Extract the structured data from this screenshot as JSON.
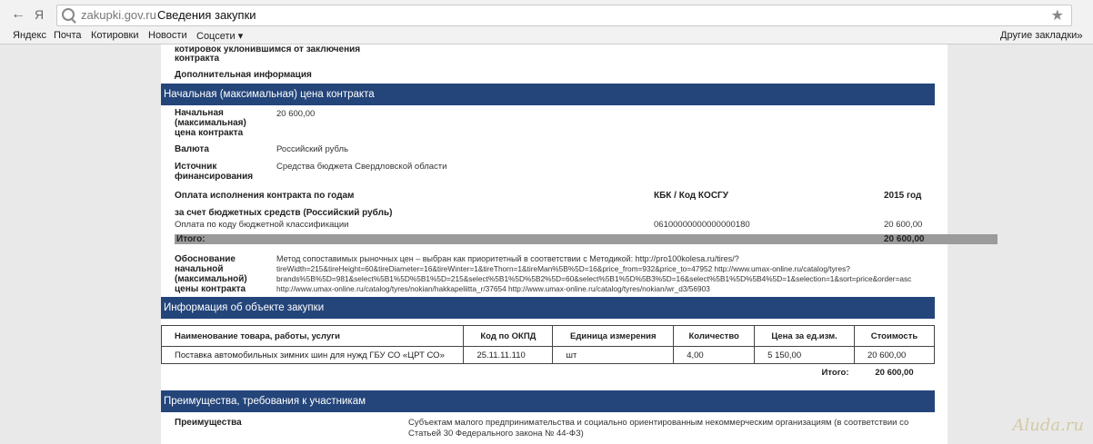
{
  "browser": {
    "domain": "zakupki.gov.ru",
    "page_title": "Сведения закупки",
    "bookmarks": [
      "Яндекс",
      "Почта",
      "Котировки",
      "Новости",
      "Соцсети"
    ],
    "other_bookmarks": "Другие закладки",
    "back_glyph": "←",
    "yandex_glyph": "Я",
    "star_glyph": "★",
    "dropdown_glyph": "▾",
    "more_glyph": "»"
  },
  "top": {
    "evasion_label_1": "котировок уклонившимся от заключения",
    "evasion_label_2": "контракта",
    "additional_info": "Дополнительная информация"
  },
  "price_section": {
    "header": "Начальная (максимальная) цена контракта",
    "nmc_label_1": "Начальная",
    "nmc_label_2": "(максимальная)",
    "nmc_label_3": "цена контракта",
    "nmc_value": "20 600,00",
    "currency_label": "Валюта",
    "currency_value": "Российский рубль",
    "source_label_1": "Источник",
    "source_label_2": "финансирования",
    "source_value": "Средства бюджета Свердловской области",
    "payment_label": "Оплата исполнения контракта по годам",
    "kbk_header": "КБК / Код КОСГУ",
    "year_header": "2015 год",
    "budget_funds": "за счет бюджетных средств (Российский рубль)",
    "payment_row_label": "Оплата по коду бюджетной классификации",
    "payment_row_kbk": "06100000000000000180",
    "payment_row_sum": "20 600,00",
    "total_label": "Итого:",
    "total_value": "20 600,00",
    "justification_label_1": "Обоснование",
    "justification_label_2": "начальной",
    "justification_label_3": "(максимальной)",
    "justification_label_4": "цены контракта",
    "justification_line_1": "Метод сопоставимых рыночных цен – выбран как приоритетный в соответствии с Методикой: http://pro100kolesa.ru/tires/?",
    "justification_line_2": "tireWidth=215&tireHeight=60&tireDiameter=16&tireWinter=1&tireThorn=1&tireMan%5B%5D=16&price_from=932&price_to=47952 http://www.umax-online.ru/catalog/tyres?",
    "justification_line_3": "brands%5B%5D=981&select%5B1%5D%5B1%5D=215&select%5B1%5D%5B2%5D=60&select%5B1%5D%5B3%5D=16&select%5B1%5D%5B4%5D=1&selection=1&sort=price&order=asc",
    "justification_line_4": "http://www.umax-online.ru/catalog/tyres/nokian/hakkapeliitta_r/37654 http://www.umax-online.ru/catalog/tyres/nokian/wr_d3/56903"
  },
  "object_section": {
    "header": "Информация об объекте закупки",
    "columns": [
      "Наименование товара, работы, услуги",
      "Код по ОКПД",
      "Единица измерения",
      "Количество",
      "Цена за ед.изм.",
      "Стоимость"
    ],
    "row": [
      "Поставка автомобильных зимних шин для нужд ГБУ СО «ЦРТ СО»",
      "25.11.11.110",
      "шт",
      "4,00",
      "5 150,00",
      "20 600,00"
    ],
    "total_label": "Итого:",
    "total_value": "20 600,00"
  },
  "advantages_section": {
    "header": "Преимущества, требования к участникам",
    "label": "Преимущества",
    "value_line_1": "Субъектам малого предпринимательства и социально ориентированным некоммерческим организациям (в соответствии со",
    "value_line_2": "Статьей 30 Федерального закона № 44-ФЗ)"
  },
  "watermark": "Aluda.ru"
}
